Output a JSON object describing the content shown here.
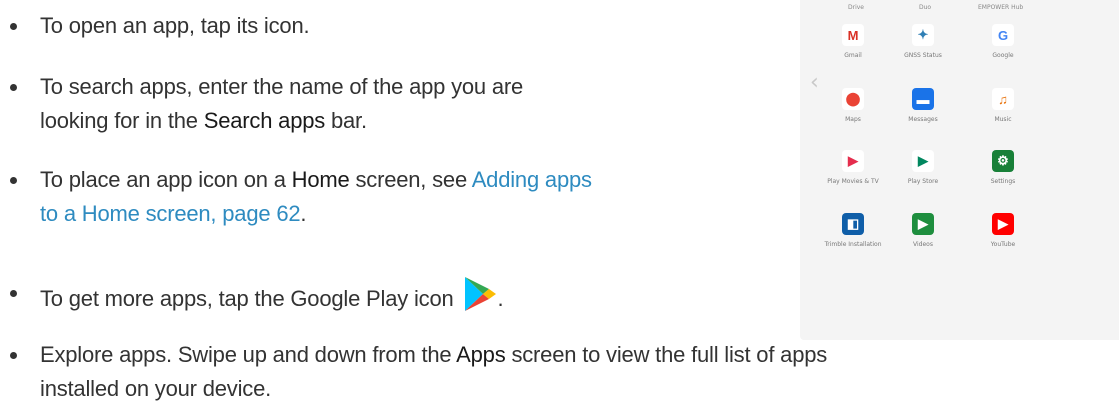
{
  "bullets": {
    "b1": "To open an app, tap its icon.",
    "b2_pre": "To search apps, enter the name of the app you are",
    "b2_line2_pre": "looking for in the ",
    "b2_bold": "Search apps",
    "b2_post": " bar.",
    "b3_pre": "To place an app icon on a ",
    "b3_bold": "Home",
    "b3_mid": " screen, see ",
    "b3_link1": "Adding apps",
    "b3_link2": "to a Home screen, page 62",
    "b3_post": ".",
    "b4_pre": "To get more apps, tap the Google Play icon",
    "b4_post": ".",
    "b5_pre": "Explore apps. Swipe up and down from the ",
    "b5_bold": "Apps",
    "b5_post": " screen to view the full list of apps",
    "b5_line2": "installed on your device."
  },
  "screenshot": {
    "top_labels": [
      "Drive",
      "Duo",
      "EMPOWER Hub"
    ],
    "apps": [
      {
        "label": "Gmail",
        "glyph": "M",
        "color": "#ffffff",
        "text_color": "#d93025"
      },
      {
        "label": "GNSS Status",
        "glyph": "✦",
        "color": "#ffffff",
        "text_color": "#2f7fb5"
      },
      {
        "label": "Google",
        "glyph": "G",
        "color": "#ffffff",
        "text_color": "#4285f4"
      },
      {
        "label": "Maps",
        "glyph": "⬤",
        "color": "#ffffff",
        "text_color": "#ea4335"
      },
      {
        "label": "Messages",
        "glyph": "▬",
        "color": "#1a73e8",
        "text_color": "#ffffff"
      },
      {
        "label": "Music",
        "glyph": "♫",
        "color": "#ffffff",
        "text_color": "#e8710a"
      },
      {
        "label": "Play Movies & TV",
        "glyph": "▶",
        "color": "#ffffff",
        "text_color": "#e52d4d"
      },
      {
        "label": "Play Store",
        "glyph": "▶",
        "color": "#ffffff",
        "text_color": "#01875f"
      },
      {
        "label": "Settings",
        "glyph": "⚙",
        "color": "#188038",
        "text_color": "#ffffff"
      },
      {
        "label": "Trimble Installation",
        "glyph": "◧",
        "color": "#0f5ea8",
        "text_color": "#ffffff"
      },
      {
        "label": "Videos",
        "glyph": "▶",
        "color": "#1e8e3e",
        "text_color": "#ffffff"
      },
      {
        "label": "YouTube",
        "glyph": "▶",
        "color": "#ff0000",
        "text_color": "#ffffff"
      }
    ]
  },
  "colors": {
    "text": "#333333",
    "link": "#2e8bc0",
    "background": "#ffffff"
  },
  "icons": {
    "play_icon": "google-play-icon"
  }
}
